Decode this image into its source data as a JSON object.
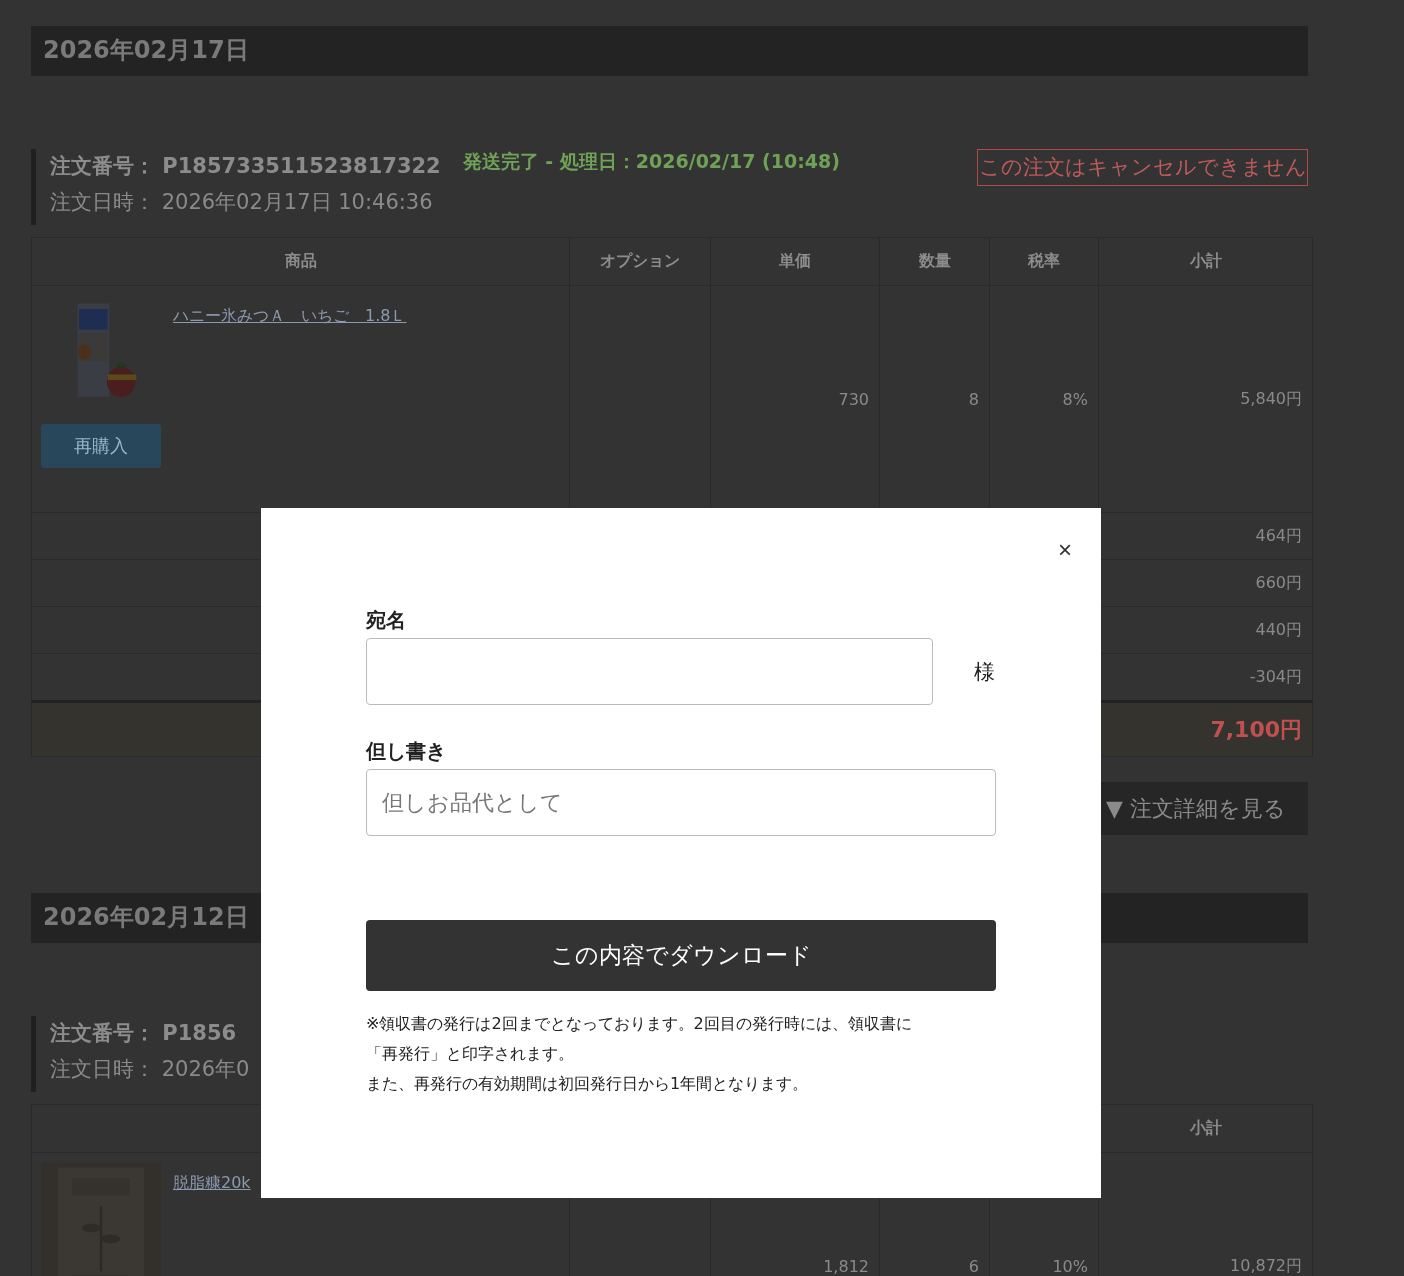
{
  "sections": [
    {
      "date": "2026年02月17日",
      "order": {
        "number_label": "注文番号：",
        "number": "P185733511523817322",
        "status": "発送完了 - 処理日：2026/02/17 (10:48)",
        "cancel_notice": "この注文はキャンセルできません",
        "date_label": "注文日時：",
        "date": "2026年02月17日 10:46:36"
      },
      "table": {
        "columns": [
          {
            "label": "商品"
          },
          {
            "label": "オプション"
          },
          {
            "label": "単価"
          },
          {
            "label": "数量"
          },
          {
            "label": "税率"
          },
          {
            "label": "小計"
          }
        ],
        "items": [
          {
            "name": "ハニー氷みつＡ　いちご　1.8Ｌ",
            "rebuy_button": "再購入",
            "unit_price": "730",
            "quantity": "8",
            "tax_rate": "8%",
            "subtotal": "5,840円"
          }
        ],
        "summary": [
          "464円",
          "660円",
          "440円",
          "-304円"
        ],
        "total": "7,100円"
      },
      "detail_button": "▼ 注文詳細を見る"
    },
    {
      "date": "2026年02月12日",
      "order": {
        "number_label": "注文番号：",
        "number": "P1856",
        "date_label": "注文日時：",
        "date": "2026年0"
      },
      "table": {
        "columns": [
          {},
          {},
          {},
          {},
          {},
          {
            "label": "小計"
          }
        ],
        "items": [
          {
            "name": "脱脂糠20k",
            "unit_price": "1,812",
            "quantity": "6",
            "tax_rate": "10%",
            "subtotal": "10,872円"
          }
        ]
      }
    }
  ],
  "modal": {
    "close": "×",
    "fields": [
      {
        "label": "宛名",
        "suffix": "様"
      },
      {
        "label": "但し書き",
        "placeholder": "但しお品代として"
      }
    ],
    "submit": "この内容でダウンロード",
    "notes": [
      "※領収書の発行は2回までとなっております。2回目の発行時には、領収書に",
      "「再発行」と印字されます。",
      "また、再発行の有効期間は初回発行日から1年間となります。"
    ]
  }
}
